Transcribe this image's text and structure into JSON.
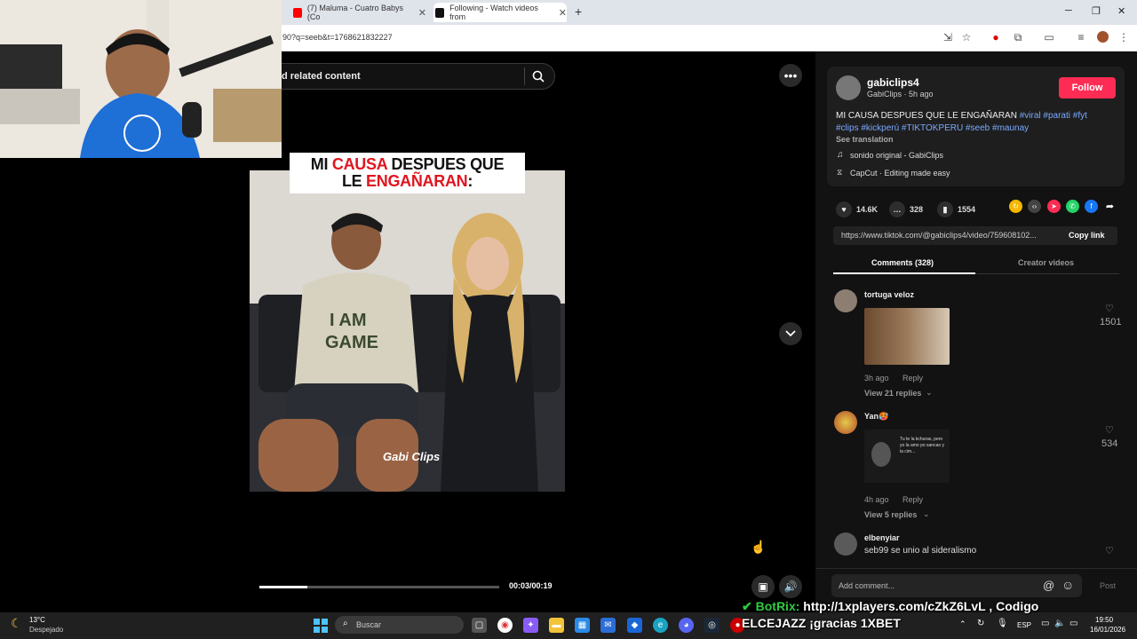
{
  "browser": {
    "tabs": [
      {
        "title": "(7) Maluma - Cuatro Babys (Co"
      },
      {
        "title": "Following - Watch videos from"
      }
    ],
    "new_tab": "+",
    "url": "90?q=seeb&t=1768621832227",
    "window_controls": {
      "minimize": "─",
      "maximize": "❐",
      "close": "✕"
    }
  },
  "player": {
    "search_text": "d related content",
    "caption_line1_a": "MI ",
    "caption_line1_b": "CAUSA",
    "caption_line1_c": " DESPUES QUE",
    "caption_line2_a": "LE ",
    "caption_line2_b": "ENGAÑARAN",
    "caption_line2_c": ":",
    "time": "00:03/00:19",
    "progress": 0.2,
    "watermark": "Gabi Clips"
  },
  "post": {
    "username": "gabiclips4",
    "subtitle": "GabiClips · 5h ago",
    "follow": "Follow",
    "desc_text": "MI CAUSA DESPUES QUE LE ENGAÑARAN",
    "hashtags_line1": "#viral #parati #fyt",
    "hashtags_line2": "#clips #kickperú #TIKTOKPERU #seeb #maunay",
    "see_translation": "See translation",
    "music": "sonido original - GabiClips",
    "capcut": "CapCut · Editing made easy",
    "likes": "14.6K",
    "comments": "328",
    "saves": "1554",
    "link": "https://www.tiktok.com/@gabiclips4/video/759608102...",
    "copy_link": "Copy link",
    "tab_comments": "Comments (328)",
    "tab_creator": "Creator videos"
  },
  "comments": [
    {
      "name": "tortuga veloz",
      "time": "3h ago",
      "reply": "Reply",
      "view_replies": "View 21 replies",
      "likes": "1501"
    },
    {
      "name": "Yan🥵",
      "time": "4h ago",
      "reply": "Reply",
      "view_replies": "View 5 replies",
      "likes": "534",
      "image_text": "Tu te la kchuras, pero yo la amo po sancao y la cim..."
    },
    {
      "name": "elbenyiar",
      "text": "seb99 se unio al sideralismo"
    }
  ],
  "comment_input": {
    "placeholder": "Add comment...",
    "post": "Post"
  },
  "taskbar": {
    "weather_temp": "13°C",
    "weather_desc": "Despejado",
    "search": "Buscar",
    "lang": "ESP",
    "time": "19:50",
    "date": "16/01/2026"
  },
  "overlay": {
    "botrix_label": "BotRix:",
    "botrix_text": "http://1xplayers.com/cZkZ6LvL , Codigo",
    "botrix_line2": "ELCEJAZZ ¡gracias 1XBET"
  },
  "colors": {
    "accent": "#fe2c55",
    "link": "#7aa9ff",
    "panel": "#121212"
  }
}
